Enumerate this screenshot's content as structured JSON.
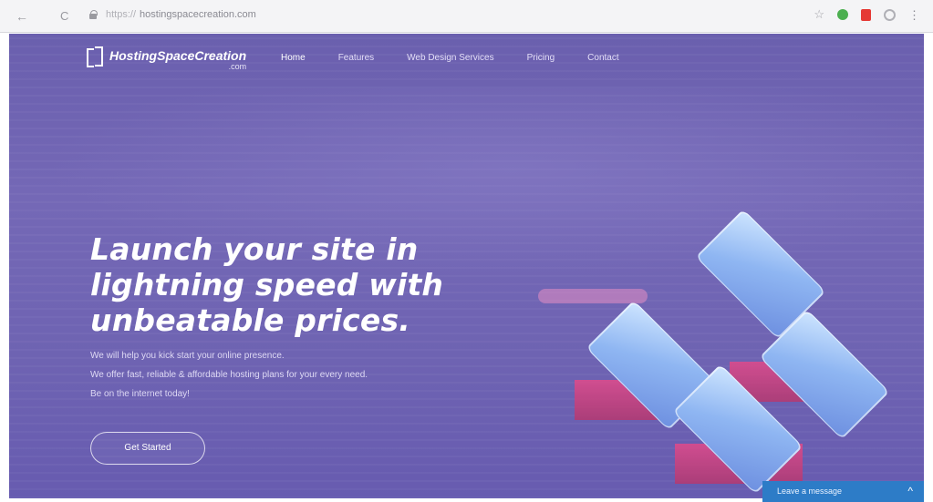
{
  "browser": {
    "back_glyph": "←",
    "reload_glyph": "C",
    "url_prefix": "https://",
    "url": "hostingspacecreation.com",
    "star_glyph": "☆",
    "menu_glyph": "⋮"
  },
  "site": {
    "logo_text": "HostingSpaceCreation",
    "logo_sub": ".com",
    "nav": [
      {
        "label": "Home"
      },
      {
        "label": "Features"
      },
      {
        "label": "Web Design Services"
      },
      {
        "label": "Pricing"
      },
      {
        "label": "Contact"
      }
    ]
  },
  "hero": {
    "headline_lines": [
      "Launch your site in",
      "lightning speed with",
      "unbeatable prices."
    ],
    "sub_lines": [
      "We will help you kick start your online presence.",
      "We offer fast, reliable & affordable hosting plans for your every need.",
      "Be on the internet today!"
    ],
    "cta_label": "Get Started"
  },
  "chat": {
    "label": "Leave a message",
    "chevron_glyph": "^"
  },
  "colors": {
    "hero_bg": "#6e63b2",
    "chat_bg": "#2d7cc7",
    "tile_blue": "#8fb6f2",
    "tile_pink": "#e24a8a"
  },
  "icons": [
    "back-arrow-icon",
    "reload-icon",
    "lock-icon",
    "star-icon",
    "extension-icon",
    "profile-icon",
    "menu-icon",
    "logo-mark-icon",
    "chevron-up-icon"
  ]
}
